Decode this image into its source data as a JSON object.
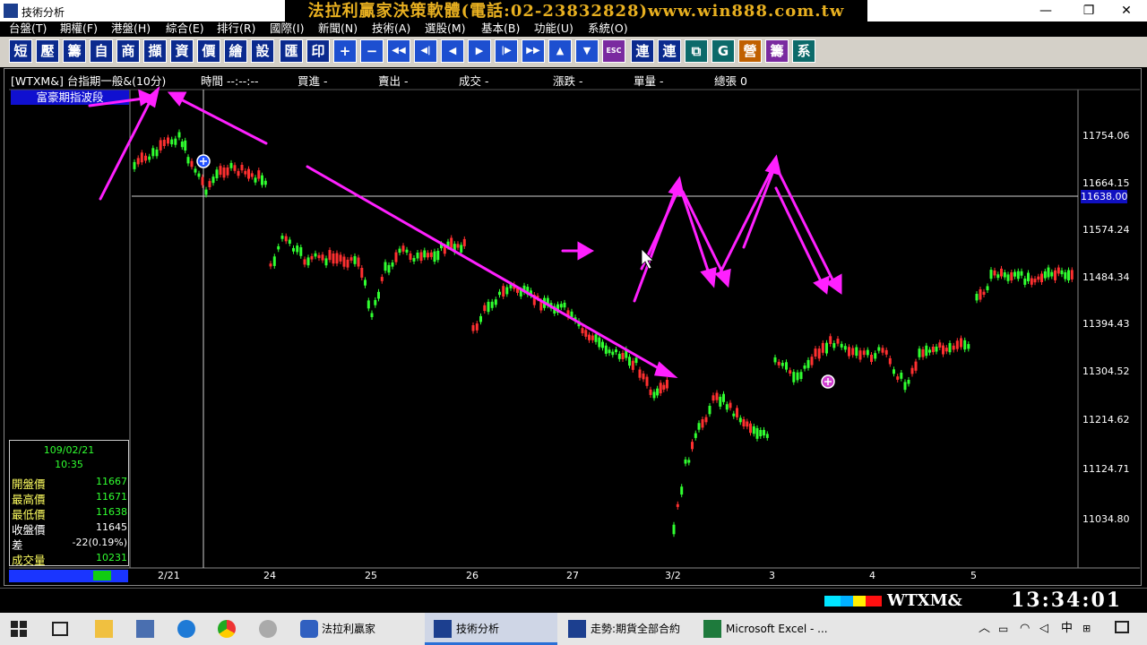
{
  "window": {
    "title": "技術分析",
    "banner": "法拉利贏家決策軟體(電話:02-23832828)www.win888.com.tw",
    "controls": {
      "minimize": "—",
      "restore": "❐",
      "close": "✕"
    }
  },
  "menu": [
    "台盤(T)",
    "期權(F)",
    "港盤(H)",
    "綜合(E)",
    "排行(R)",
    "國際(I)",
    "新聞(N)",
    "技術(A)",
    "選股(M)",
    "基本(B)",
    "功能(U)",
    "系統(O)"
  ],
  "toolbar": [
    "短",
    "壓",
    "籌",
    "自",
    "商",
    "擷",
    "資",
    "價",
    "繪",
    "設",
    "匯",
    "印",
    "+",
    "−",
    "◀◀",
    "◀|",
    "◀",
    "▶",
    "|▶",
    "▶▶",
    "▲",
    "▼",
    "ESC",
    "連",
    "連",
    "⧉",
    "G",
    "營",
    "籌",
    "系"
  ],
  "chart_header": {
    "symbol": "[WTXM&] 台指期一般&(10分)",
    "time_label": "時間 --:--:--",
    "bid": "買進 -",
    "ask": "賣出 -",
    "deal": "成交 -",
    "change": "漲跌 -",
    "volume": "單量 -",
    "total": "總張 0"
  },
  "panel_label": "富豪期指波段",
  "info": {
    "date": "109/02/21",
    "time": "10:35",
    "open_label": "開盤價",
    "open": "11667",
    "high_label": "最高價",
    "high": "11671",
    "low_label": "最低價",
    "low": "11638",
    "close_label": "收盤價",
    "close": "11645",
    "diff_label": "差",
    "diff": "-22(0.19%)",
    "vol_label": "成交量",
    "vol": "10231"
  },
  "y_axis": [
    "11754.06",
    "11664.15",
    "11574.24",
    "11484.34",
    "11394.43",
    "11304.52",
    "11214.62",
    "11124.71",
    "11034.80"
  ],
  "current_price": "11638.00",
  "x_axis": [
    "2/21",
    "24",
    "25",
    "26",
    "27",
    "3/2",
    "3",
    "4",
    "5"
  ],
  "status": {
    "symbol": "WTXM&",
    "time": "13:34:01"
  },
  "taskbar": {
    "items": [
      "法拉利贏家",
      "技術分析",
      "走勢:期貨全部合約",
      "Microsoft Excel - ..."
    ],
    "ime": "中"
  },
  "colors": {
    "up": "#ff3030",
    "down": "#30ff30",
    "annotation": "#ff20ff",
    "label_bg": "#1010d0"
  }
}
